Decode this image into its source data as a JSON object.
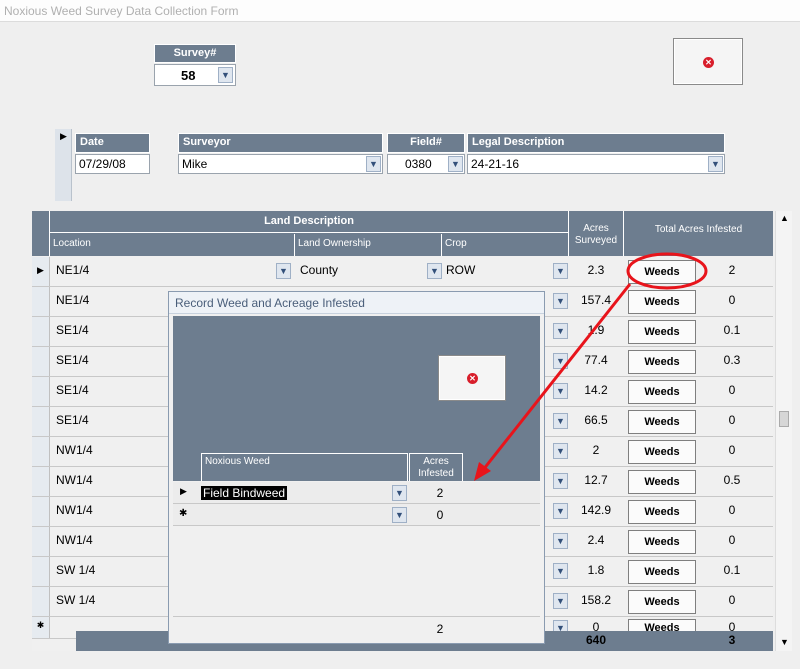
{
  "window": {
    "title": "Noxious Weed Survey Data Collection Form"
  },
  "survey": {
    "label": "Survey#",
    "value": "58"
  },
  "header": {
    "date_label": "Date",
    "date_value": "07/29/08",
    "surveyor_label": "Surveyor",
    "surveyor_value": "Mike",
    "field_label": "Field#",
    "field_value": "0380",
    "legal_label": "Legal Description",
    "legal_value": "24-21-16"
  },
  "grid": {
    "group_header": "Land Description",
    "col_location": "Location",
    "col_ownership": "Land Ownership",
    "col_crop": "Crop",
    "col_acres": "Acres Surveyed",
    "col_infested": "Total Acres Infested",
    "weeds_label": "Weeds",
    "rows": [
      {
        "location": "NE1/4",
        "ownership": "County",
        "crop": "ROW",
        "acres": "2.3",
        "infested": "2"
      },
      {
        "location": "NE1/4",
        "ownership": "",
        "crop": "",
        "acres": "157.4",
        "infested": "0"
      },
      {
        "location": "SE1/4",
        "ownership": "",
        "crop": "",
        "acres": "1.9",
        "infested": "0.1"
      },
      {
        "location": "SE1/4",
        "ownership": "",
        "crop": "",
        "acres": "77.4",
        "infested": "0.3"
      },
      {
        "location": "SE1/4",
        "ownership": "",
        "crop": "",
        "acres": "14.2",
        "infested": "0"
      },
      {
        "location": "SE1/4",
        "ownership": "",
        "crop": "",
        "acres": "66.5",
        "infested": "0"
      },
      {
        "location": "NW1/4",
        "ownership": "",
        "crop": "",
        "acres": "2",
        "infested": "0"
      },
      {
        "location": "NW1/4",
        "ownership": "",
        "crop": "",
        "acres": "12.7",
        "infested": "0.5"
      },
      {
        "location": "NW1/4",
        "ownership": "",
        "crop": "",
        "acres": "142.9",
        "infested": "0"
      },
      {
        "location": "NW1/4",
        "ownership": "",
        "crop": "",
        "acres": "2.4",
        "infested": "0"
      },
      {
        "location": "SW 1/4",
        "ownership": "",
        "crop": "",
        "acres": "1.8",
        "infested": "0.1"
      },
      {
        "location": "SW 1/4",
        "ownership": "",
        "crop": "",
        "acres": "158.2",
        "infested": "0"
      },
      {
        "location": "",
        "ownership": "",
        "crop": "",
        "acres": "0",
        "infested": "0"
      }
    ],
    "total_acres": "640",
    "total_infested": "3"
  },
  "dialog": {
    "title": "Record Weed and Acreage Infested",
    "col_weed": "Noxious Weed",
    "col_acres": "Acres Infested",
    "rows": [
      {
        "weed": "Field Bindweed",
        "acres": "2"
      },
      {
        "weed": "",
        "acres": "0"
      }
    ],
    "total": "2"
  },
  "colors": {
    "header_bg": "#6d7d8f",
    "annotation": "#e8141b"
  }
}
